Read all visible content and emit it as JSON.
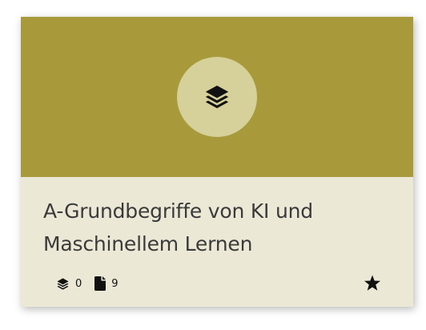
{
  "card": {
    "title": "A-Grundbegriffe von KI und Maschinellem Lernen",
    "header_icon": "layers-icon",
    "stats": {
      "modules_count": "0",
      "modules_icon": "layers-icon",
      "documents_count": "9",
      "documents_icon": "file-icon"
    },
    "favorite_icon": "star-icon"
  },
  "colors": {
    "header_bg": "#a89a3b",
    "icon_circle": "#d6d09a",
    "body_bg": "#ece8d6",
    "text": "#3a3a3a"
  }
}
